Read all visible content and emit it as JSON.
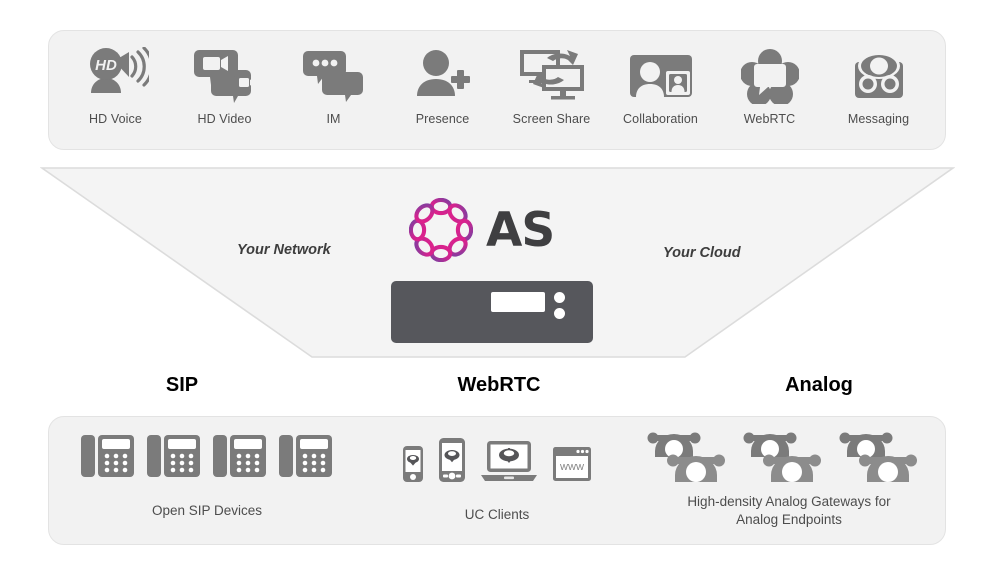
{
  "features": {
    "items": [
      {
        "label": "HD Voice",
        "icon": "hd-voice-icon"
      },
      {
        "label": "HD Video",
        "icon": "hd-video-icon"
      },
      {
        "label": "IM",
        "icon": "instant-message-icon"
      },
      {
        "label": "Presence",
        "icon": "presence-add-user-icon"
      },
      {
        "label": "Screen Share",
        "icon": "screen-share-icon"
      },
      {
        "label": "Collaboration",
        "icon": "collaboration-icon"
      },
      {
        "label": "WebRTC",
        "icon": "webrtc-icon"
      },
      {
        "label": "Messaging",
        "icon": "messaging-voicemail-icon"
      }
    ]
  },
  "funnel": {
    "left_zone_label": "Your Network",
    "right_zone_label": "Your Cloud"
  },
  "brand": {
    "name": "AS",
    "mark_icon": "as-ring-logo-icon",
    "mark_gradient_start": "#e0218a",
    "mark_gradient_end": "#7b3fa0",
    "text_color": "#3f3f41"
  },
  "server": {
    "icon": "server-appliance-icon",
    "body_color": "#56575c",
    "led_count": 2
  },
  "sections": [
    {
      "heading": "SIP"
    },
    {
      "heading": "WebRTC"
    },
    {
      "heading": "Analog"
    }
  ],
  "endpoints": {
    "groups": [
      {
        "label": "Open SIP Devices",
        "icon": "desk-phone-icon",
        "icon_count": 4
      },
      {
        "label": "UC Clients",
        "icons": [
          "smartphone-small-client-icon",
          "smartphone-large-client-icon",
          "laptop-client-icon",
          "browser-www-client-icon"
        ],
        "browser_text": "WWW"
      },
      {
        "label": "High-density Analog Gateways for\nAnalog Endpoints",
        "label_line1": "High-density Analog Gateways for",
        "label_line2": "Analog Endpoints",
        "icon": "analog-phone-pair-icon",
        "icon_count": 3
      }
    ]
  },
  "palette": {
    "panel_fill": "#f2f2f2",
    "panel_border": "#e3e3e3",
    "icon_gray": "#7b7b7b",
    "label_gray": "#4d4d4d",
    "heading_black": "#000000",
    "funnel_fill": "#f4f4f4",
    "funnel_border": "#dcdcdc"
  }
}
